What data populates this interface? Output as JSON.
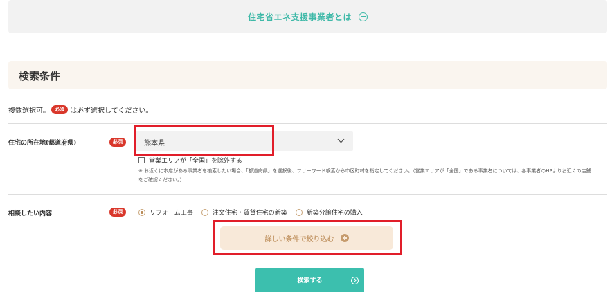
{
  "accordion": {
    "label": "住宅省エネ支援事業者とは",
    "icon": "plus-circle-icon"
  },
  "section": {
    "title": "検索条件"
  },
  "note": {
    "prefix": "複数選択可。",
    "badge": "必須",
    "suffix": "は必ず選択してください。"
  },
  "prefecture": {
    "label": "住宅の所在地(都道府県)",
    "required_badge": "必須",
    "selected": "熊本県",
    "exclude_checkbox": {
      "label": "営業エリアが「全国」を除外する",
      "checked": false
    },
    "help_text": "※ お近くに本店がある事業者を検索したい場合、「都道府県」を選択後、フリーワード検索から市区町村を指定してください。（営業エリアが「全国」である事業者については、各事業者のHPよりお近くの店舗をご確認ください。）"
  },
  "consult": {
    "label": "相談したい内容",
    "required_badge": "必須",
    "options": [
      {
        "label": "リフォーム工事",
        "checked": true
      },
      {
        "label": "注文住宅・賃貸住宅の新築",
        "checked": false
      },
      {
        "label": "新築分譲住宅の購入",
        "checked": false
      }
    ]
  },
  "filter_button": {
    "label": "詳しい条件で絞り込む"
  },
  "search_button": {
    "label": "検索する"
  },
  "colors": {
    "teal": "#3cbfae",
    "beige": "#f8e9d9",
    "required_red": "#d9372b",
    "highlight_red": "#e11e2a"
  }
}
